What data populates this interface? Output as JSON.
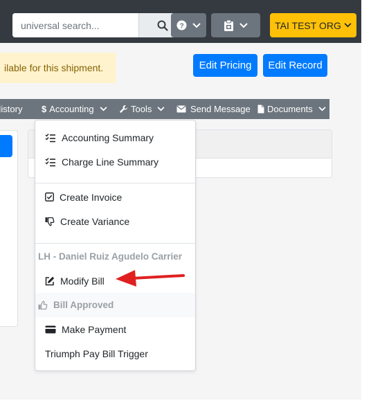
{
  "topbar": {
    "search_placeholder": "universal search...",
    "org_label": "TAI TEST ORG"
  },
  "alert_text": "ilable for this shipment.",
  "actions": {
    "edit_pricing": "Edit Pricing",
    "edit_record": "Edit Record"
  },
  "nav": {
    "history": "History",
    "accounting": "Accounting",
    "tools": "Tools",
    "send_message": "Send Message",
    "documents": "Documents"
  },
  "menu": {
    "accounting_summary": "Accounting Summary",
    "charge_line_summary": "Charge Line Summary",
    "create_invoice": "Create Invoice",
    "create_variance": "Create Variance",
    "carrier_header": "LH - Daniel Ruiz Agudelo Carrier",
    "modify_bill": "Modify Bill",
    "bill_approved": "Bill Approved",
    "make_payment": "Make Payment",
    "triumph_trigger": "Triumph Pay Bill Trigger"
  },
  "colors": {
    "topbar": "#343a40",
    "org_button": "#ffc107",
    "primary": "#007bff",
    "nav": "#6c757d",
    "alert": "#fff3cd",
    "annotation_arrow": "#e02020"
  }
}
